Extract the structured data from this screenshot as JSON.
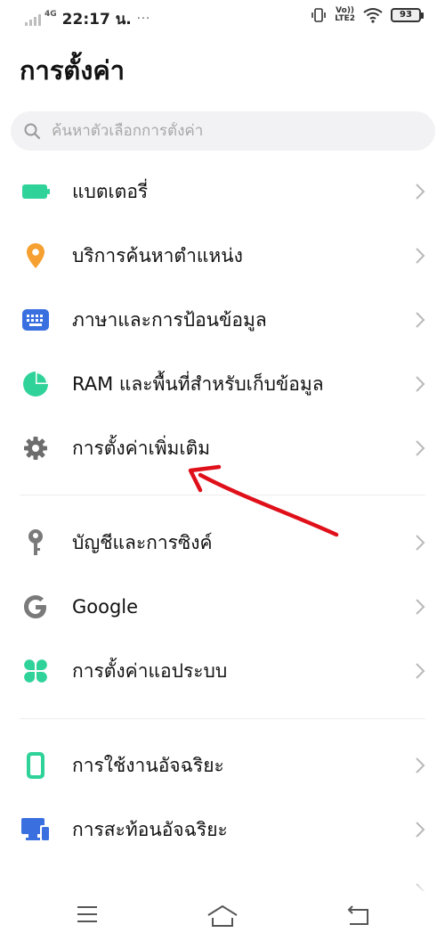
{
  "status_bar": {
    "network_type": "4G",
    "time": "22:17 น.",
    "more": "···",
    "volte_top": "Vo))",
    "volte_bottom": "LTE2",
    "battery": "93"
  },
  "title": "การตั้งค่า",
  "search": {
    "placeholder": "ค้นหาตัวเลือกการตั้งค่า"
  },
  "items": [
    {
      "label": "แบตเตอรี่",
      "icon": "battery-icon",
      "color": "#2fd39a"
    },
    {
      "label": "บริการค้นหาตำแหน่ง",
      "icon": "location-pin-icon",
      "color": "#f5a030"
    },
    {
      "label": "ภาษาและการป้อนข้อมูล",
      "icon": "keyboard-icon",
      "color": "#3a6fe0"
    },
    {
      "label": "RAM และพื้นที่สำหรับเก็บข้อมูล",
      "icon": "storage-pie-icon",
      "color": "#2fd39a"
    },
    {
      "label": "การตั้งค่าเพิ่มเติม",
      "icon": "gear-icon",
      "color": "#6d6d6d"
    },
    {
      "label": "บัญชีและการซิงค์",
      "icon": "key-icon",
      "color": "#7a7a7a"
    },
    {
      "label": "Google",
      "icon": "google-icon",
      "color": "#7a7a7a"
    },
    {
      "label": "การตั้งค่าแอประบบ",
      "icon": "apps-clover-icon",
      "color": "#2fd39a"
    },
    {
      "label": "การใช้งานอัจฉริยะ",
      "icon": "smart-phone-icon",
      "color": "#2fd39a"
    },
    {
      "label": "การสะท้อนอัจฉริยะ",
      "icon": "screen-mirror-icon",
      "color": "#3a6fe0"
    }
  ],
  "nav": {
    "menu": "menu-icon",
    "home": "home-icon",
    "back": "back-icon"
  },
  "annotation_color": "#e0101a"
}
